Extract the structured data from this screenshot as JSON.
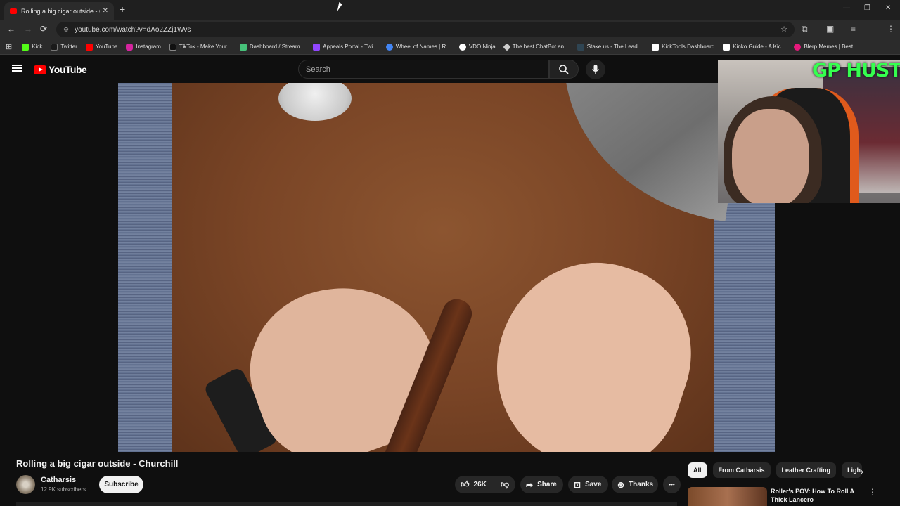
{
  "browser": {
    "tab_title": "Rolling a big cigar outside - Ch",
    "tab_close": "✕",
    "new_tab": "+",
    "url": "youtube.com/watch?v=dAo2ZZj1Wvs",
    "window_controls": [
      "—",
      "❐",
      "✕"
    ]
  },
  "bookmarks": [
    {
      "label": "Kick",
      "color": "#53fc18"
    },
    {
      "label": "Twitter",
      "color": "#1a1a1a"
    },
    {
      "label": "YouTube",
      "color": "#ff0000"
    },
    {
      "label": "Instagram",
      "color": "#d6249f"
    },
    {
      "label": "TikTok - Make Your...",
      "color": "#111111"
    },
    {
      "label": "Dashboard / Stream...",
      "color": "#47c27a"
    },
    {
      "label": "Appeals Portal - Twi...",
      "color": "#9146ff"
    },
    {
      "label": "Wheel of Names | R...",
      "color": "#4285f4"
    },
    {
      "label": "VDO.Ninja",
      "color": "#ffffff"
    },
    {
      "label": "The best ChatBot an...",
      "color": "#cccccc"
    },
    {
      "label": "Stake.us - The Leadi...",
      "color": "#2f4553"
    },
    {
      "label": "KickTools Dashboard",
      "color": "#ffffff"
    },
    {
      "label": "Kinko Guide - A Kic...",
      "color": "#ffffff"
    },
    {
      "label": "Blerp Memes | Best...",
      "color": "#e6197c"
    }
  ],
  "youtube": {
    "logo_text": "YouTube",
    "search_placeholder": "Search",
    "stream_overlay": "GP HUSTLA"
  },
  "video": {
    "title": "Rolling a big cigar outside - Churchill",
    "channel": "Catharsis",
    "subscribers": "12.9K subscribers",
    "subscribe_label": "Subscribe",
    "likes": "26K",
    "share_label": "Share",
    "save_label": "Save",
    "thanks_label": "Thanks",
    "more": "•••"
  },
  "sidebar": {
    "chips": [
      "All",
      "From Catharsis",
      "Leather Crafting",
      "Ligh"
    ],
    "recommended": {
      "title": "Roller's POV: How To Roll A Thick Lancero",
      "more": "⋮"
    }
  }
}
